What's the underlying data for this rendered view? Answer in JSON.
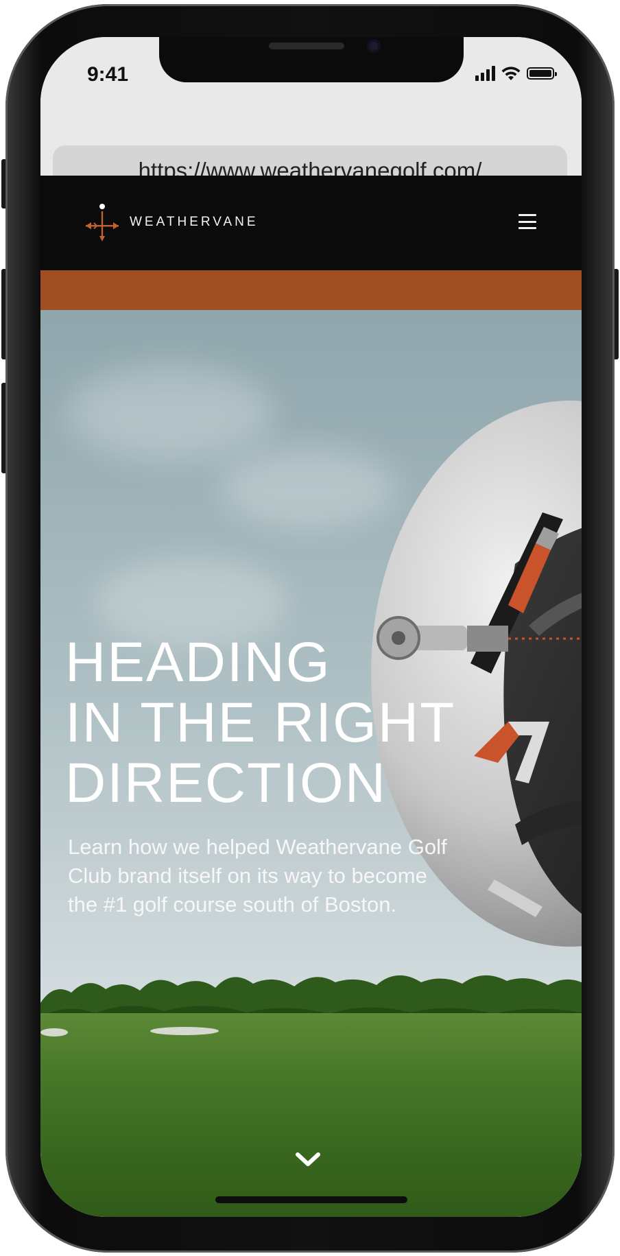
{
  "status_bar": {
    "time": "9:41",
    "signal_bars": 4,
    "battery_level": 1.0
  },
  "browser": {
    "url": "https://www.weathervanegolf.com/"
  },
  "site_header": {
    "logo_text": "WEATHERVANE",
    "menu_icon": "hamburger-icon"
  },
  "hero": {
    "title_lines": [
      "HEADING",
      "IN THE RIGHT",
      "DIRECTION"
    ],
    "description": "Learn how we helped Weathervane Golf Club brand itself on its way to become the #1 golf course south of Boston.",
    "scroll_icon": "chevron-down-icon"
  },
  "colors": {
    "accent": "#a04e24",
    "header_bg": "#0b0b0b",
    "text_light": "#ffffff"
  }
}
